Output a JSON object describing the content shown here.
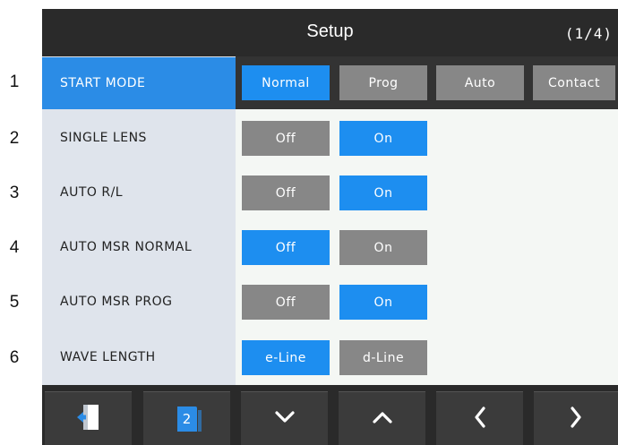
{
  "header": {
    "title": "Setup",
    "page": "(1/4)"
  },
  "rows": [
    {
      "num": "1",
      "label": "START MODE"
    },
    {
      "num": "2",
      "label": "SINGLE LENS"
    },
    {
      "num": "3",
      "label": "AUTO R/L"
    },
    {
      "num": "4",
      "label": "AUTO MSR NORMAL"
    },
    {
      "num": "5",
      "label": "AUTO MSR PROG"
    },
    {
      "num": "6",
      "label": "WAVE LENGTH"
    }
  ],
  "start_mode": {
    "options": [
      "Normal",
      "Prog",
      "Auto",
      "Contact"
    ],
    "selected": "Normal"
  },
  "single_lens": {
    "options": [
      "Off",
      "On"
    ],
    "selected": "On"
  },
  "auto_rl": {
    "options": [
      "Off",
      "On"
    ],
    "selected": "On"
  },
  "auto_msr_normal": {
    "options": [
      "Off",
      "On"
    ],
    "selected": "Off"
  },
  "auto_msr_prog": {
    "options": [
      "Off",
      "On"
    ],
    "selected": "On"
  },
  "wave_length": {
    "options": [
      "e-Line",
      "d-Line"
    ],
    "selected": "e-Line"
  },
  "footer": {
    "exit_icon": "exit-door-icon",
    "page_badge": "2",
    "down_icon": "chevron-down-icon",
    "up_icon": "chevron-up-icon",
    "prev_icon": "chevron-left-icon",
    "next_icon": "chevron-right-icon"
  },
  "colors": {
    "accent": "#1d8ef0",
    "inactive_button": "#878787",
    "header": "#2a2a2a",
    "label_column": "#dfe4ec"
  }
}
